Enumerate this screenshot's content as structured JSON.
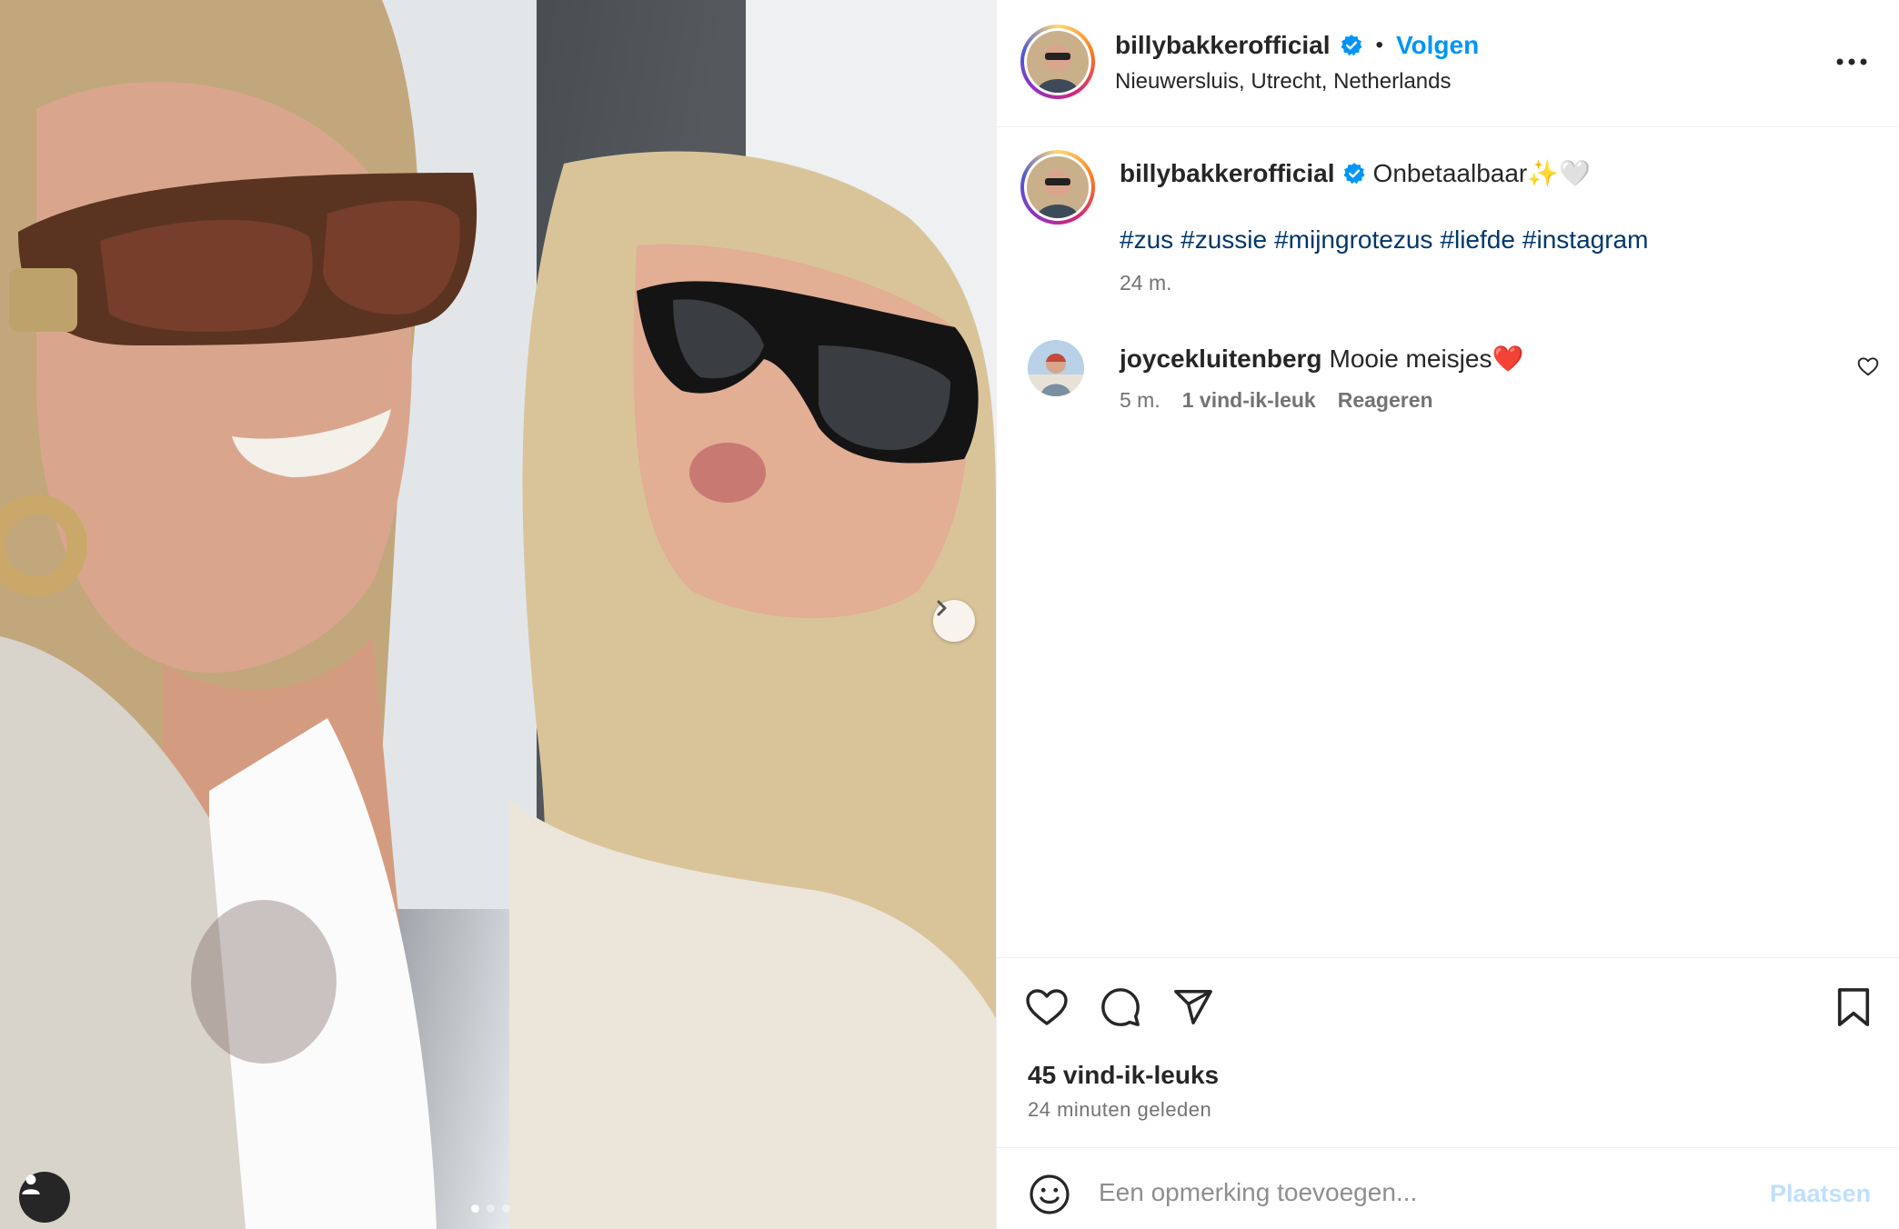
{
  "post": {
    "username": "billybakkerofficial",
    "verified_icon": "verified-badge-icon",
    "separator": "•",
    "follow_label": "Volgen",
    "location": "Nieuwersluis, Utrecht, Netherlands"
  },
  "caption": {
    "username": "billybakkerofficial",
    "text": "Onbetaalbaar✨🤍",
    "hashtags": [
      "#zus",
      "#zussie",
      "#mijngrotezus",
      "#liefde",
      "#instagram"
    ],
    "time": "24 m."
  },
  "comments": [
    {
      "username": "joycekluitenberg",
      "text": "Mooie meisjes❤️",
      "time": "5 m.",
      "likes": "1 vind-ik-leuk",
      "reply_label": "Reageren"
    }
  ],
  "stats": {
    "likes": "45 vind-ik-leuks",
    "posted": "24 minuten geleden"
  },
  "comment_bar": {
    "placeholder": "Een opmerking toevoegen...",
    "post_label": "Plaatsen"
  },
  "carousel": {
    "total_slides": 3,
    "active_slide": 1
  },
  "colors": {
    "link_blue": "#0095f6",
    "hashtag_blue": "#00376b",
    "muted_text": "#737373",
    "disabled_post": "#c0dffd"
  }
}
